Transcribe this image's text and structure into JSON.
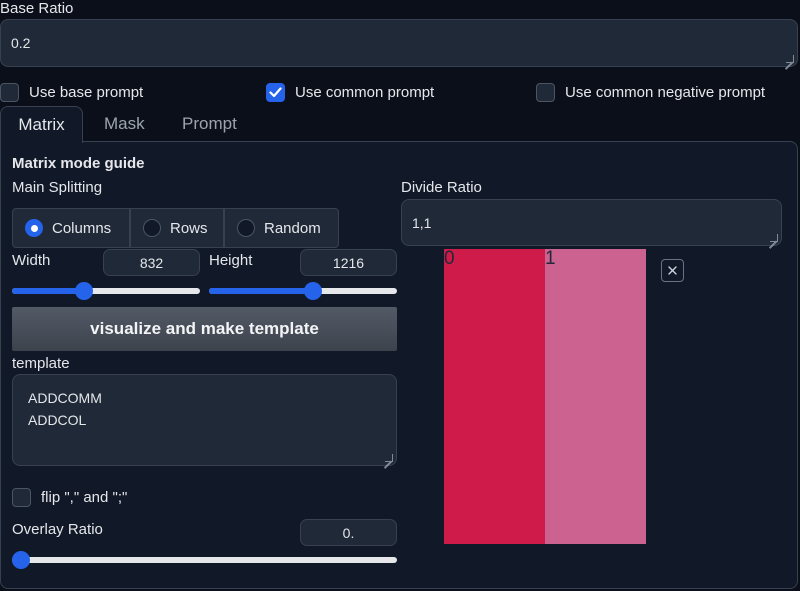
{
  "base_ratio": {
    "label": "Base Ratio",
    "value": "0.2"
  },
  "options": {
    "use_base_prompt": {
      "label": "Use base prompt",
      "checked": false
    },
    "use_common_prompt": {
      "label": "Use common prompt",
      "checked": true
    },
    "use_common_negative_prompt": {
      "label": "Use common negative prompt",
      "checked": false
    }
  },
  "tabs": [
    {
      "label": "Matrix",
      "active": true
    },
    {
      "label": "Mask",
      "active": false
    },
    {
      "label": "Prompt",
      "active": false
    }
  ],
  "matrix": {
    "guide_title": "Matrix mode guide",
    "main_splitting_label": "Main Splitting",
    "splitting_options": [
      "Columns",
      "Rows",
      "Random"
    ],
    "splitting_selected": "Columns",
    "width": {
      "label": "Width",
      "value": "832",
      "fraction": 0.37
    },
    "height": {
      "label": "Height",
      "value": "1216",
      "fraction": 0.56
    },
    "visualize_button": "visualize and make template",
    "template_label": "template",
    "template_lines": [
      "ADDCOMM",
      "ADDCOL"
    ],
    "flip_label": "flip \",\" and \";\"",
    "flip_checked": false,
    "overlay": {
      "label": "Overlay Ratio",
      "value": "0.",
      "fraction": 0.0
    },
    "divide_ratio": {
      "label": "Divide Ratio",
      "value": "1,1"
    },
    "preview": {
      "regions": [
        {
          "label": "0",
          "color": "#cf1b4a"
        },
        {
          "label": "1",
          "color": "#cb6290"
        }
      ]
    }
  }
}
